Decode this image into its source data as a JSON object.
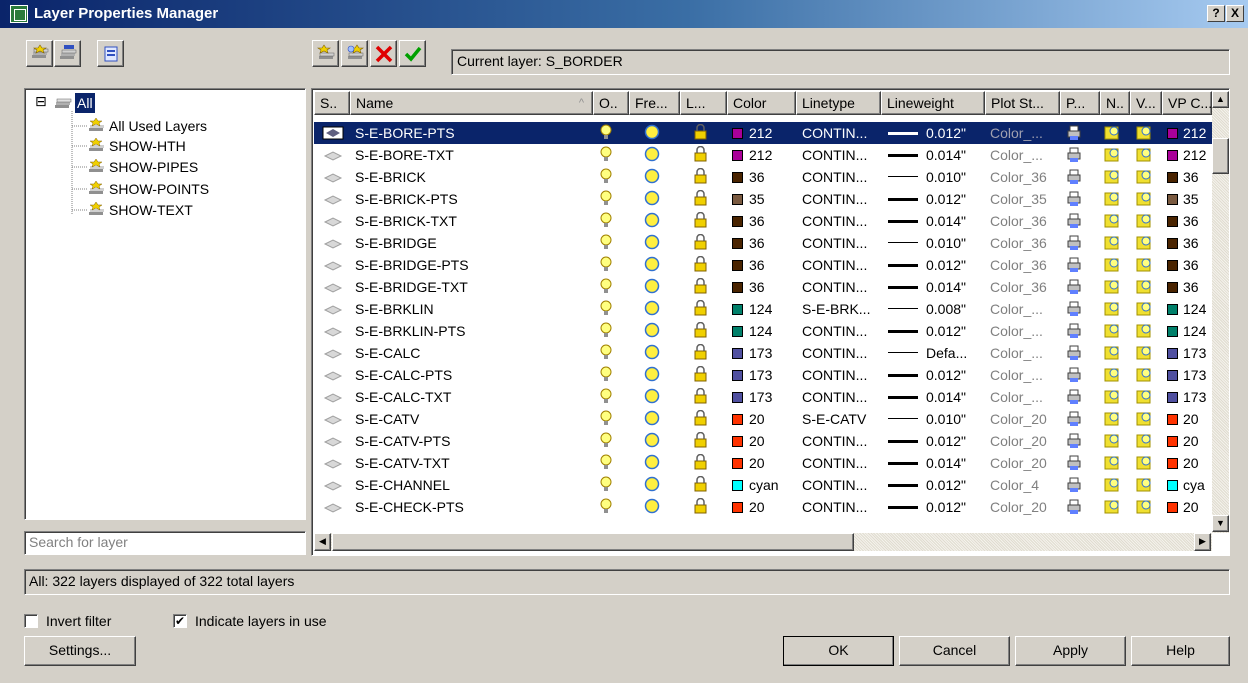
{
  "window": {
    "title": "Layer Properties Manager",
    "help_btn": "?",
    "close_btn": "X"
  },
  "toolbar": {
    "current_layer_label": "Current layer: S_BORDER"
  },
  "tree": {
    "root": "All",
    "expander": "⊟",
    "children": [
      "All Used Layers",
      "SHOW-HTH",
      "SHOW-PIPES",
      "SHOW-POINTS",
      "SHOW-TEXT"
    ]
  },
  "search": {
    "placeholder": "Search for layer"
  },
  "grid": {
    "columns": [
      "S..",
      "Name",
      "O..",
      "Fre...",
      "L...",
      "Color",
      "Linetype",
      "Lineweight",
      "Plot St...",
      "P...",
      "N..",
      "V...",
      "VP C..."
    ],
    "sort_arrow": "^",
    "selected_index": 0,
    "rows": [
      {
        "name": "S-E-BORE-PTS",
        "color": "212",
        "swatch": "#aa0099",
        "linetype": "CONTIN...",
        "lineweight": "0.012\"",
        "lw_heavy": true,
        "plot_style": "Color_..."
      },
      {
        "name": "S-E-BORE-TXT",
        "color": "212",
        "swatch": "#aa0099",
        "linetype": "CONTIN...",
        "lineweight": "0.014\"",
        "lw_heavy": true,
        "plot_style": "Color_..."
      },
      {
        "name": "S-E-BRICK",
        "color": "36",
        "swatch": "#4a2400",
        "linetype": "CONTIN...",
        "lineweight": "0.010\"",
        "lw_heavy": false,
        "plot_style": "Color_36"
      },
      {
        "name": "S-E-BRICK-PTS",
        "color": "35",
        "swatch": "#7a5a40",
        "linetype": "CONTIN...",
        "lineweight": "0.012\"",
        "lw_heavy": true,
        "plot_style": "Color_35"
      },
      {
        "name": "S-E-BRICK-TXT",
        "color": "36",
        "swatch": "#4a2400",
        "linetype": "CONTIN...",
        "lineweight": "0.014\"",
        "lw_heavy": true,
        "plot_style": "Color_36"
      },
      {
        "name": "S-E-BRIDGE",
        "color": "36",
        "swatch": "#4a2400",
        "linetype": "CONTIN...",
        "lineweight": "0.010\"",
        "lw_heavy": false,
        "plot_style": "Color_36"
      },
      {
        "name": "S-E-BRIDGE-PTS",
        "color": "36",
        "swatch": "#4a2400",
        "linetype": "CONTIN...",
        "lineweight": "0.012\"",
        "lw_heavy": true,
        "plot_style": "Color_36"
      },
      {
        "name": "S-E-BRIDGE-TXT",
        "color": "36",
        "swatch": "#4a2400",
        "linetype": "CONTIN...",
        "lineweight": "0.014\"",
        "lw_heavy": true,
        "plot_style": "Color_36"
      },
      {
        "name": "S-E-BRKLIN",
        "color": "124",
        "swatch": "#00806a",
        "linetype": "S-E-BRK...",
        "lineweight": "0.008\"",
        "lw_heavy": false,
        "plot_style": "Color_..."
      },
      {
        "name": "S-E-BRKLIN-PTS",
        "color": "124",
        "swatch": "#00806a",
        "linetype": "CONTIN...",
        "lineweight": "0.012\"",
        "lw_heavy": true,
        "plot_style": "Color_..."
      },
      {
        "name": "S-E-CALC",
        "color": "173",
        "swatch": "#5050a0",
        "linetype": "CONTIN...",
        "lineweight": "Defa...",
        "lw_heavy": false,
        "plot_style": "Color_..."
      },
      {
        "name": "S-E-CALC-PTS",
        "color": "173",
        "swatch": "#5050a0",
        "linetype": "CONTIN...",
        "lineweight": "0.012\"",
        "lw_heavy": true,
        "plot_style": "Color_..."
      },
      {
        "name": "S-E-CALC-TXT",
        "color": "173",
        "swatch": "#5050a0",
        "linetype": "CONTIN...",
        "lineweight": "0.014\"",
        "lw_heavy": true,
        "plot_style": "Color_..."
      },
      {
        "name": "S-E-CATV",
        "color": "20",
        "swatch": "#ff3300",
        "linetype": "S-E-CATV",
        "lineweight": "0.010\"",
        "lw_heavy": false,
        "plot_style": "Color_20"
      },
      {
        "name": "S-E-CATV-PTS",
        "color": "20",
        "swatch": "#ff3300",
        "linetype": "CONTIN...",
        "lineweight": "0.012\"",
        "lw_heavy": true,
        "plot_style": "Color_20"
      },
      {
        "name": "S-E-CATV-TXT",
        "color": "20",
        "swatch": "#ff3300",
        "linetype": "CONTIN...",
        "lineweight": "0.014\"",
        "lw_heavy": true,
        "plot_style": "Color_20"
      },
      {
        "name": "S-E-CHANNEL",
        "color": "cyan",
        "vp_color": "cya",
        "swatch": "#00ffff",
        "linetype": "CONTIN...",
        "lineweight": "0.012\"",
        "lw_heavy": true,
        "plot_style": "Color_4"
      },
      {
        "name": "S-E-CHECK-PTS",
        "color": "20",
        "swatch": "#ff3300",
        "linetype": "CONTIN...",
        "lineweight": "0.012\"",
        "lw_heavy": true,
        "plot_style": "Color_20"
      }
    ]
  },
  "status": {
    "text": "All: 322 layers displayed of 322 total layers"
  },
  "options": {
    "invert_filter": {
      "label": "Invert filter",
      "checked": false
    },
    "indicate_in_use": {
      "label": "Indicate layers in use",
      "checked": true,
      "mark": "✔"
    }
  },
  "buttons": {
    "settings": "Settings...",
    "ok": "OK",
    "cancel": "Cancel",
    "apply": "Apply",
    "help": "Help"
  },
  "scroll": {
    "up": "▲",
    "down": "▼",
    "left": "◀",
    "right": "▶"
  }
}
